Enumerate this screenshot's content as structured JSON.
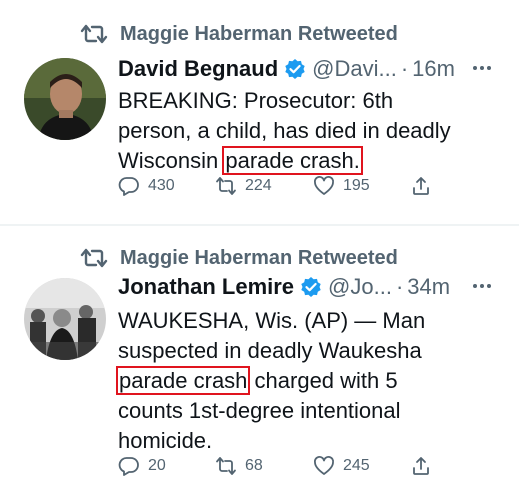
{
  "tweets": [
    {
      "retweeted_by": "Maggie Haberman Retweeted",
      "name": "David Begnaud",
      "handle": "@Davi...",
      "sep": "·",
      "time": "16m",
      "text_lines": [
        "BREAKING: Prosecutor: 6th",
        "person, a child, has died in deadly",
        "Wisconsin "
      ],
      "highlight": "parade crash.",
      "reply_count": "430",
      "retweet_count": "224",
      "like_count": "195"
    },
    {
      "retweeted_by": "Maggie Haberman Retweeted",
      "name": "Jonathan Lemire",
      "handle": "@Jo...",
      "sep": "·",
      "time": "34m",
      "text_lines_before": [
        "WAUKESHA, Wis. (AP) — Man",
        "suspected in deadly Waukesha"
      ],
      "highlight": "parade crash",
      "after_highlight": " charged with 5",
      "text_lines_after": [
        "counts 1st-degree intentional",
        "homicide."
      ],
      "reply_count": "20",
      "retweet_count": "68",
      "like_count": "245"
    }
  ],
  "colors": {
    "secondary": "#536471",
    "verified": "#1d9bf0",
    "highlight_box": "#e0141e"
  }
}
